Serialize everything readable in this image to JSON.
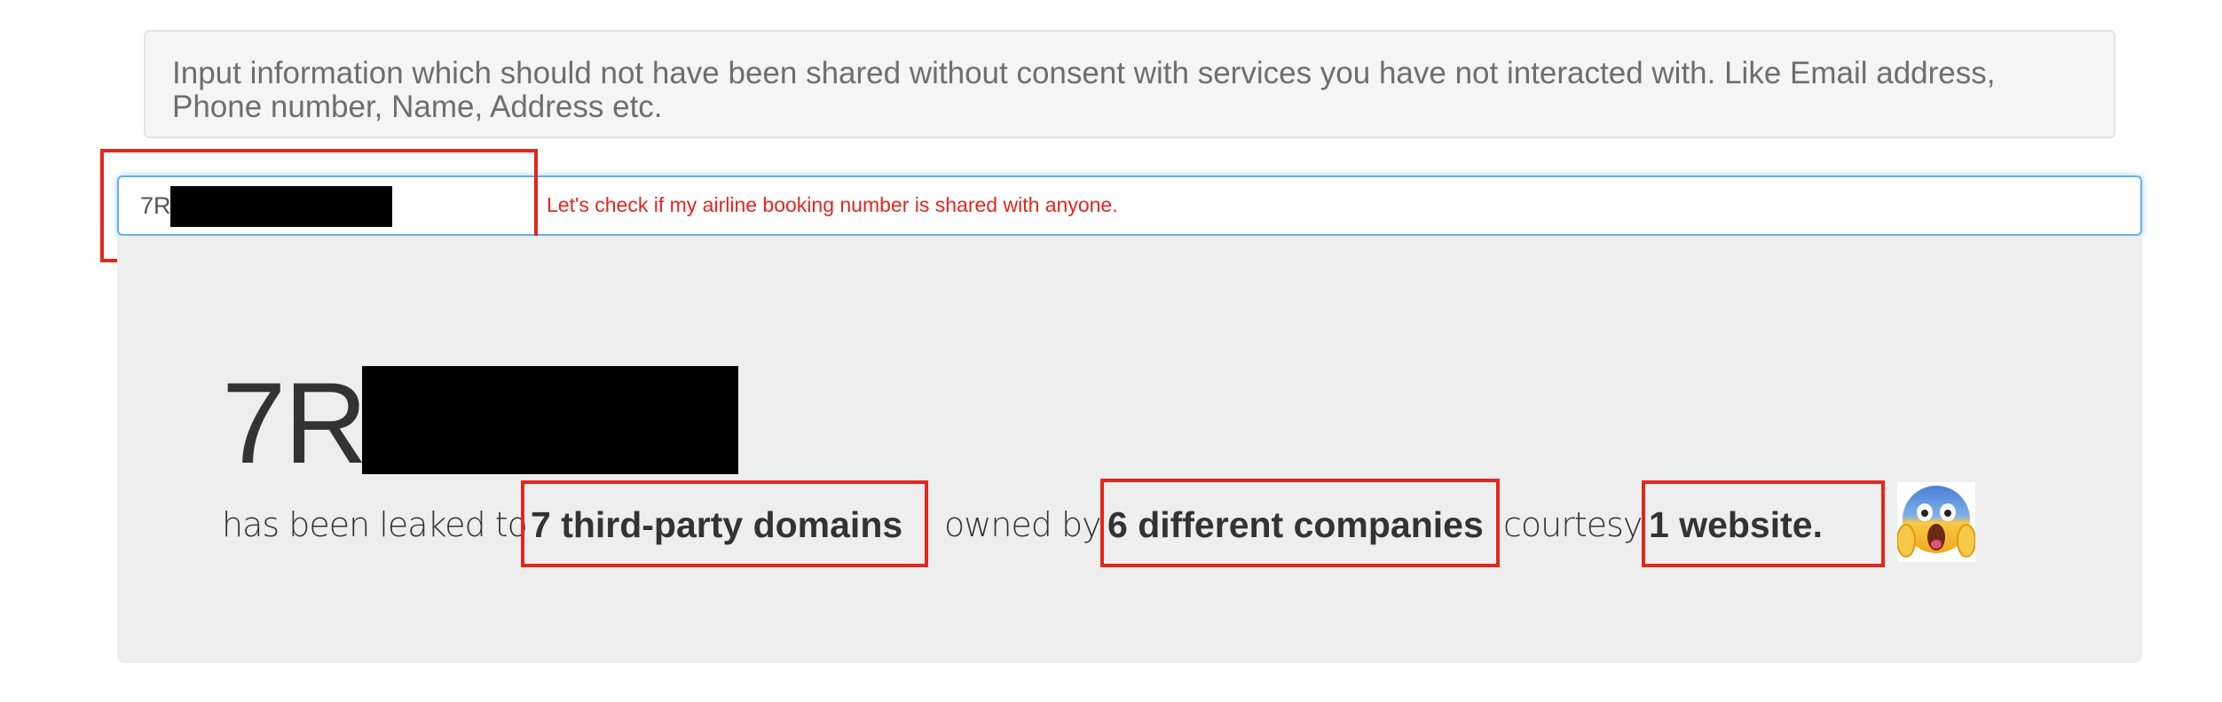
{
  "info_text": "Input information which should not have been shared without consent with services you have not interacted with. Like Email address, Phone number, Name, Address etc.",
  "search": {
    "value": "7R"
  },
  "annotation": "Let's check if my airline booking number is shared with anyone.",
  "result": {
    "title": "7R",
    "prefix": "has been leaked to",
    "domains": "7 third-party domains",
    "owned_by": "owned by",
    "companies": "6 different companies",
    "courtesy": "courtesy",
    "websites": "1 website.",
    "reaction_icon": "screaming-face-emoji-icon"
  },
  "colors": {
    "annotation_red": "#e2271d",
    "input_focus": "#66afe9",
    "panel_bg": "#eeeeee",
    "well_bg": "#f5f5f5"
  }
}
